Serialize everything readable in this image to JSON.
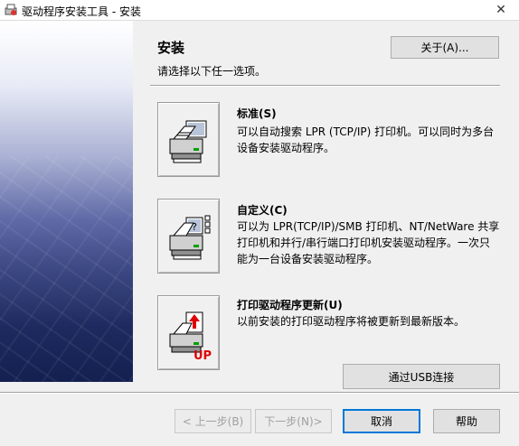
{
  "window": {
    "title": "驱动程序安装工具 - 安装",
    "close_glyph": "✕"
  },
  "header": {
    "heading": "安装",
    "subtitle": "请选择以下任一选项。",
    "about_label": "关于(A)..."
  },
  "options": [
    {
      "title": "标准(S)",
      "description": "可以自动搜索 LPR (TCP/IP) 打印机。可以同时为多台设备安装驱动程序。",
      "icon": "standard-printer-icon"
    },
    {
      "title": "自定义(C)",
      "description": "可以为 LPR(TCP/IP)/SMB 打印机、NT/NetWare 共享打印机和并行/串行端口打印机安装驱动程序。一次只能为一台设备安装驱动程序。",
      "icon": "custom-printer-icon"
    },
    {
      "title": "打印驱动程序更新(U)",
      "description": "以前安装的打印驱动程序将被更新到最新版本。",
      "icon": "update-printer-icon",
      "icon_text": "UP"
    }
  ],
  "usb_button": "通过USB连接",
  "footer": {
    "back": "< 上一步(B)",
    "next": "下一步(N)>",
    "cancel": "取消",
    "help": "帮助"
  },
  "colors": {
    "accent": "#0078d7",
    "update_red": "#e00000"
  }
}
